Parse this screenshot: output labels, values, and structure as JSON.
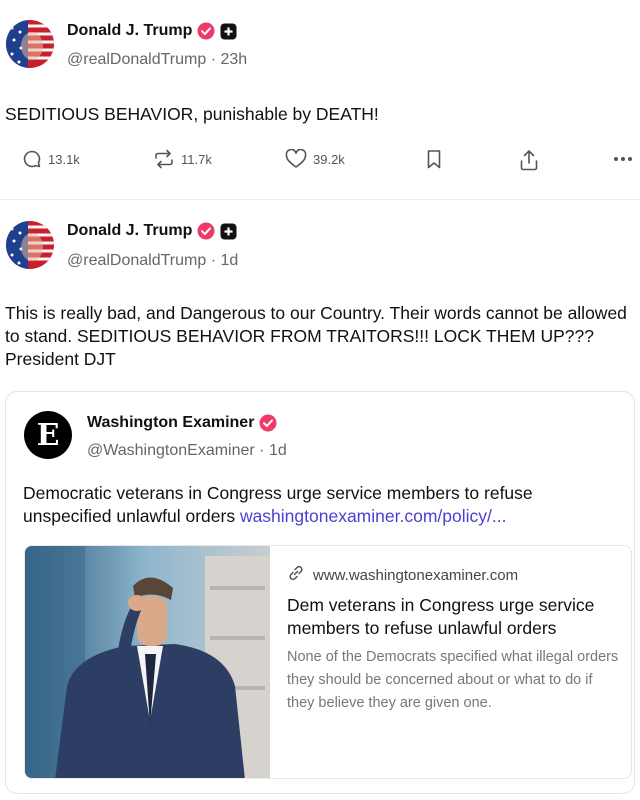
{
  "posts": [
    {
      "author": {
        "name": "Donald J. Trump",
        "handle": "@realDonaldTrump",
        "time": "23h"
      },
      "text": "SEDITIOUS BEHAVIOR, punishable by DEATH!",
      "actions": {
        "replies": "13.1k",
        "reposts": "11.7k",
        "likes": "39.2k"
      }
    },
    {
      "author": {
        "name": "Donald J. Trump",
        "handle": "@realDonaldTrump",
        "time": "1d"
      },
      "text": "This is really bad, and Dangerous to our Country. Their words cannot be allowed to stand. SEDITIOUS BEHAVIOR FROM TRAITORS!!! LOCK THEM UP??? President DJT",
      "quote": {
        "author": {
          "name": "Washington Examiner",
          "handle": "@WashingtonExaminer",
          "time": "1d",
          "logo_letter": "E"
        },
        "text": "Democratic veterans in Congress urge service members to refuse unspecified unlawful orders ",
        "link_text": "washingtonexaminer.com/policy/...",
        "card": {
          "domain": "www.washingtonexaminer.com",
          "title": "Dem veterans in Congress urge service members to refuse unlawful orders",
          "description": "None of the Democrats specified what illegal orders they should be concerned about or what to do if they believe they are given one."
        }
      }
    }
  ],
  "separator": " · ",
  "colors": {
    "verified": "#ef3b6b",
    "link": "#4b3fd1",
    "muted": "#666666"
  },
  "icons": [
    "reply-icon",
    "repost-icon",
    "like-icon",
    "bookmark-icon",
    "share-icon",
    "more-icon",
    "verified-icon",
    "plus-badge-icon",
    "link-icon"
  ]
}
